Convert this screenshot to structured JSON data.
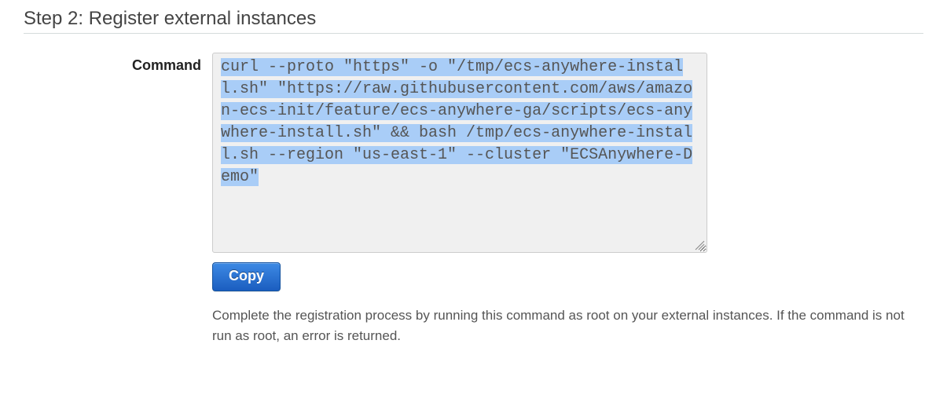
{
  "step": {
    "title": "Step 2: Register external instances"
  },
  "command_section": {
    "label": "Command",
    "code_selected": "curl --proto \"https\" -o \"/tmp/ecs-anywhere-install.sh\" \"https://raw.githubusercontent.com/aws/amazon-ecs-init/feature/ecs-anywhere-ga/scripts/ecs-anywhere-install.sh\"  && bash /tmp/ecs-anywhere-install.sh --region \"us-east-1\" --cluster \"ECSAnywhere-Demo\"",
    "copy_label": "Copy",
    "help_text": "Complete the registration process by running this command as root on your external instances. If the command is not run as root, an error is returned."
  }
}
